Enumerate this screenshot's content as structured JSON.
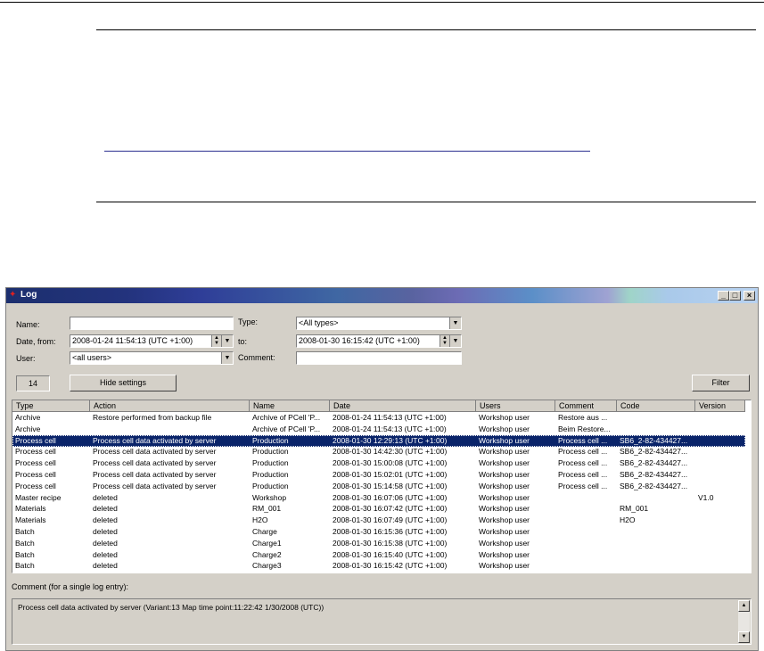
{
  "window": {
    "title": "Log"
  },
  "titlebar_buttons": {
    "minimize": "_",
    "maximize": "□",
    "close": "×"
  },
  "filters": {
    "name_label": "Name:",
    "name_value": "",
    "type_label": "Type:",
    "type_value": "<All types>",
    "date_from_label": "Date, from:",
    "date_from_value": "2008-01-24 11:54:13 (UTC +1:00)",
    "to_label": "to:",
    "to_value": "2008-01-30 16:15:42 (UTC +1:00)",
    "user_label": "User:",
    "user_value": "<all users>",
    "comment_label": "Comment:",
    "comment_value": ""
  },
  "toolbar": {
    "count": "14",
    "hide_settings": "Hide settings",
    "filter": "Filter"
  },
  "table": {
    "columns": [
      "Type",
      "Action",
      "Name",
      "Date",
      "Users",
      "Comment",
      "Code",
      "Version"
    ],
    "rows": [
      {
        "type": "Archive",
        "action": "Restore performed from backup file",
        "name": "Archive of PCell 'P...",
        "date": "2008-01-24 11:54:13 (UTC +1:00)",
        "users": "Workshop user",
        "comment": "Restore aus ...",
        "code": "",
        "version": ""
      },
      {
        "type": "Archive",
        "action": "",
        "name": "Archive of PCell 'P...",
        "date": "2008-01-24 11:54:13 (UTC +1:00)",
        "users": "Workshop user",
        "comment": "Beim Restore...",
        "code": "",
        "version": ""
      },
      {
        "type": "Process cell",
        "action": "Process cell data activated by server",
        "name": "Production",
        "date": "2008-01-30 12:29:13 (UTC +1:00)",
        "users": "Workshop user",
        "comment": "Process cell ...",
        "code": "SB6_2-82-434427...",
        "version": ""
      },
      {
        "type": "Process cell",
        "action": "Process cell data activated by server",
        "name": "Production",
        "date": "2008-01-30 14:42:30 (UTC +1:00)",
        "users": "Workshop user",
        "comment": "Process cell ...",
        "code": "SB6_2-82-434427...",
        "version": ""
      },
      {
        "type": "Process cell",
        "action": "Process cell data activated by server",
        "name": "Production",
        "date": "2008-01-30 15:00:08 (UTC +1:00)",
        "users": "Workshop user",
        "comment": "Process cell ...",
        "code": "SB6_2-82-434427...",
        "version": ""
      },
      {
        "type": "Process cell",
        "action": "Process cell data activated by server",
        "name": "Production",
        "date": "2008-01-30 15:02:01 (UTC +1:00)",
        "users": "Workshop user",
        "comment": "Process cell ...",
        "code": "SB6_2-82-434427...",
        "version": ""
      },
      {
        "type": "Process cell",
        "action": "Process cell data activated by server",
        "name": "Production",
        "date": "2008-01-30 15:14:58 (UTC +1:00)",
        "users": "Workshop user",
        "comment": "Process cell ...",
        "code": "SB6_2-82-434427...",
        "version": ""
      },
      {
        "type": "Master recipe",
        "action": "deleted",
        "name": "Workshop",
        "date": "2008-01-30 16:07:06 (UTC +1:00)",
        "users": "Workshop user",
        "comment": "",
        "code": "",
        "version": "V1.0"
      },
      {
        "type": "Materials",
        "action": "deleted",
        "name": "RM_001",
        "date": "2008-01-30 16:07:42 (UTC +1:00)",
        "users": "Workshop user",
        "comment": "",
        "code": "RM_001",
        "version": ""
      },
      {
        "type": "Materials",
        "action": "deleted",
        "name": "H2O",
        "date": "2008-01-30 16:07:49 (UTC +1:00)",
        "users": "Workshop user",
        "comment": "",
        "code": "H2O",
        "version": ""
      },
      {
        "type": "Batch",
        "action": "deleted",
        "name": "Charge",
        "date": "2008-01-30 16:15:36 (UTC +1:00)",
        "users": "Workshop user",
        "comment": "",
        "code": "",
        "version": ""
      },
      {
        "type": "Batch",
        "action": "deleted",
        "name": "Charge1",
        "date": "2008-01-30 16:15:38 (UTC +1:00)",
        "users": "Workshop user",
        "comment": "",
        "code": "",
        "version": ""
      },
      {
        "type": "Batch",
        "action": "deleted",
        "name": "Charge2",
        "date": "2008-01-30 16:15:40 (UTC +1:00)",
        "users": "Workshop user",
        "comment": "",
        "code": "",
        "version": ""
      },
      {
        "type": "Batch",
        "action": "deleted",
        "name": "Charge3",
        "date": "2008-01-30 16:15:42 (UTC +1:00)",
        "users": "Workshop user",
        "comment": "",
        "code": "",
        "version": ""
      }
    ],
    "selected_row": 2
  },
  "comment_section": {
    "label": "Comment (for a single log entry):",
    "text": "Process cell data activated by server (Variant:13 Map time point:11:22:42 1/30/2008 (UTC))"
  },
  "icons": {
    "app": "log-app-icon",
    "dropdown": "chevron-down-icon",
    "spin": "spin-updown-icon"
  },
  "colors": {
    "selection": "#0a246a",
    "window_bg": "#d4d0c8",
    "rule_blue": "#2b2f8f"
  }
}
